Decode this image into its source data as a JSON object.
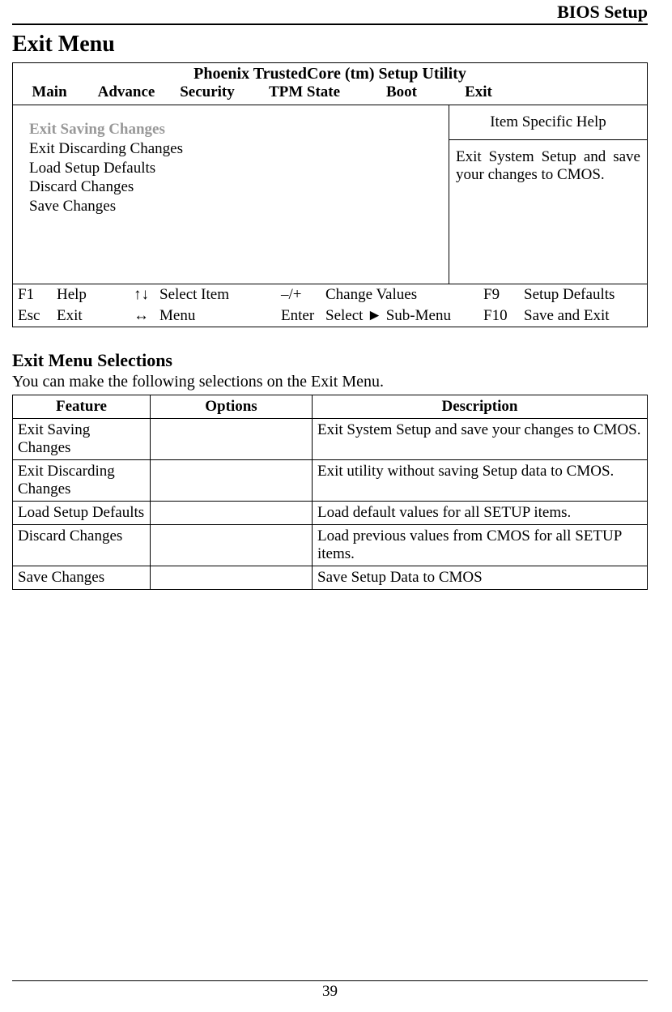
{
  "header": {
    "section": "BIOS Setup"
  },
  "title": "Exit Menu",
  "bios": {
    "utility_title": "Phoenix TrustedCore (tm) Setup Utility",
    "tabs": {
      "main": "Main",
      "advance": "Advance",
      "security": "Security",
      "tpm": "TPM State",
      "boot": "Boot",
      "exit": "Exit"
    },
    "menu": {
      "selected": "Exit Saving Changes",
      "items": [
        "Exit Discarding Changes",
        "Load Setup Defaults",
        "Discard Changes",
        "Save Changes"
      ]
    },
    "help": {
      "title": "Item Specific Help",
      "body": "Exit System Setup and save your changes to CMOS."
    },
    "footer": {
      "r1": {
        "k1": "F1",
        "l1": "Help",
        "k2": "↑↓",
        "l2": "Select Item",
        "k3": "–/+",
        "l3": "Change Values",
        "k4": "F9",
        "l4": "Setup Defaults"
      },
      "r2": {
        "k1": "Esc",
        "l1": "Exit",
        "k2": "↔",
        "l2": "Menu",
        "k3": "Enter",
        "l3": "Select ► Sub-Menu",
        "k4": "F10",
        "l4": "Save and Exit"
      }
    }
  },
  "selections": {
    "heading": "Exit Menu Selections",
    "lead": "You can make the following selections on the Exit Menu.",
    "headers": {
      "feature": "Feature",
      "options": "Options",
      "description": "Description"
    },
    "rows": [
      {
        "feature": "Exit Saving Changes",
        "options": "",
        "description": "Exit System Setup and save your changes to CMOS."
      },
      {
        "feature": "Exit Discarding Changes",
        "options": "",
        "description": "Exit utility without saving Setup data to CMOS."
      },
      {
        "feature": "Load Setup Defaults",
        "options": "",
        "description": "Load default values for all SETUP items."
      },
      {
        "feature": "Discard Changes",
        "options": "",
        "description": "Load previous values from CMOS for all SETUP items."
      },
      {
        "feature": "Save Changes",
        "options": "",
        "description": "Save Setup Data to CMOS"
      }
    ]
  },
  "page_number": "39"
}
